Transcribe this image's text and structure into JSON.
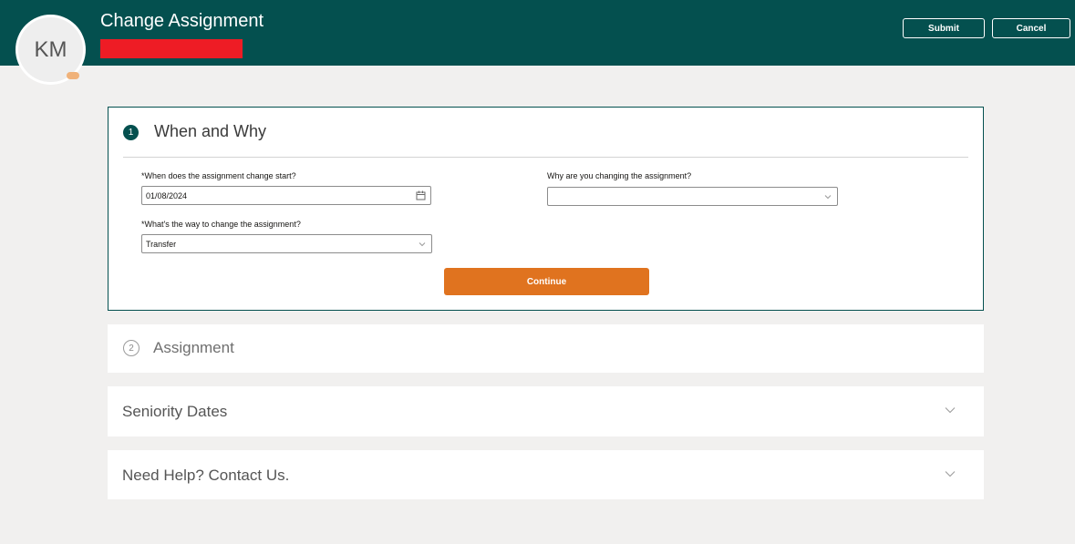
{
  "header": {
    "avatar_initials": "KM",
    "title": "Change Assignment",
    "submit_label": "Submit",
    "cancel_label": "Cancel",
    "bg_color": "#04504f"
  },
  "step1": {
    "number": "1",
    "title": "When and Why",
    "start_date": {
      "label": "*When does the assignment change start?",
      "value": "01/08/2024",
      "icon": "calendar-icon"
    },
    "reason": {
      "label": "Why are you changing the assignment?",
      "value": ""
    },
    "way": {
      "label": "*What's the way to change the assignment?",
      "value": "Transfer"
    },
    "continue_label": "Continue",
    "accent_color": "#e0731f"
  },
  "step2": {
    "number": "2",
    "title": "Assignment"
  },
  "sections": {
    "seniority_title": "Seniority Dates",
    "help_title": "Need Help? Contact Us."
  }
}
